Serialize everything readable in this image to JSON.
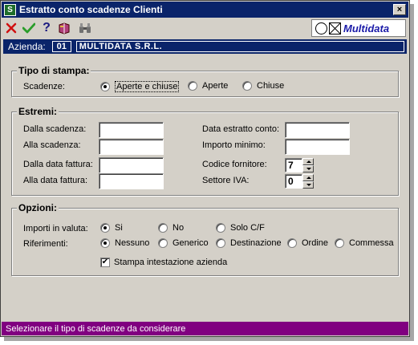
{
  "window": {
    "title": "Estratto conto scadenze Clienti",
    "app_icon": "S",
    "close_label": "×"
  },
  "toolbar": {
    "icons": [
      "cancel-icon",
      "confirm-icon",
      "help-icon",
      "book-icon",
      "binoculars-icon"
    ],
    "help_label": "?",
    "logo_text": "Multidata"
  },
  "azienda": {
    "label": "Azienda:",
    "code": "01",
    "name": "MULTIDATA S.R.L."
  },
  "tipo_stampa": {
    "legend": "Tipo di stampa:",
    "scadenze_label": "Scadenze:",
    "options": [
      "Aperte e chiuse",
      "Aperte",
      "Chiuse"
    ],
    "selected": "Aperte e chiuse"
  },
  "estremi": {
    "legend": "Estremi:",
    "dalla_scadenza": "Dalla scadenza:",
    "alla_scadenza": "Alla scadenza:",
    "dalla_data_fattura": "Dalla data fattura:",
    "alla_data_fattura": "Alla data fattura:",
    "data_estratto_conto": "Data estratto conto:",
    "importo_minimo": "Importo minimo:",
    "codice_fornitore": "Codice fornitore:",
    "codice_fornitore_value": "7",
    "settore_iva": "Settore IVA:",
    "settore_iva_value": "0"
  },
  "opzioni": {
    "legend": "Opzioni:",
    "importi_label": "Importi in valuta:",
    "importi_options": [
      "Si",
      "No",
      "Solo C/F"
    ],
    "importi_selected": "Si",
    "riferimenti_label": "Riferimenti:",
    "riferimenti_options": [
      "Nessuno",
      "Generico",
      "Destinazione",
      "Ordine",
      "Commessa"
    ],
    "riferimenti_selected": "Nessuno",
    "stampa_intestazione": "Stampa intestazione azienda",
    "stampa_intestazione_checked": true,
    "check_mark": "✔"
  },
  "status": {
    "text": "Selezionare il tipo di scadenze da considerare"
  },
  "colors": {
    "titlebar": "#0a246a",
    "statusbar": "#800080",
    "face": "#d4d0c8",
    "logo_text": "#1a1aa8"
  }
}
